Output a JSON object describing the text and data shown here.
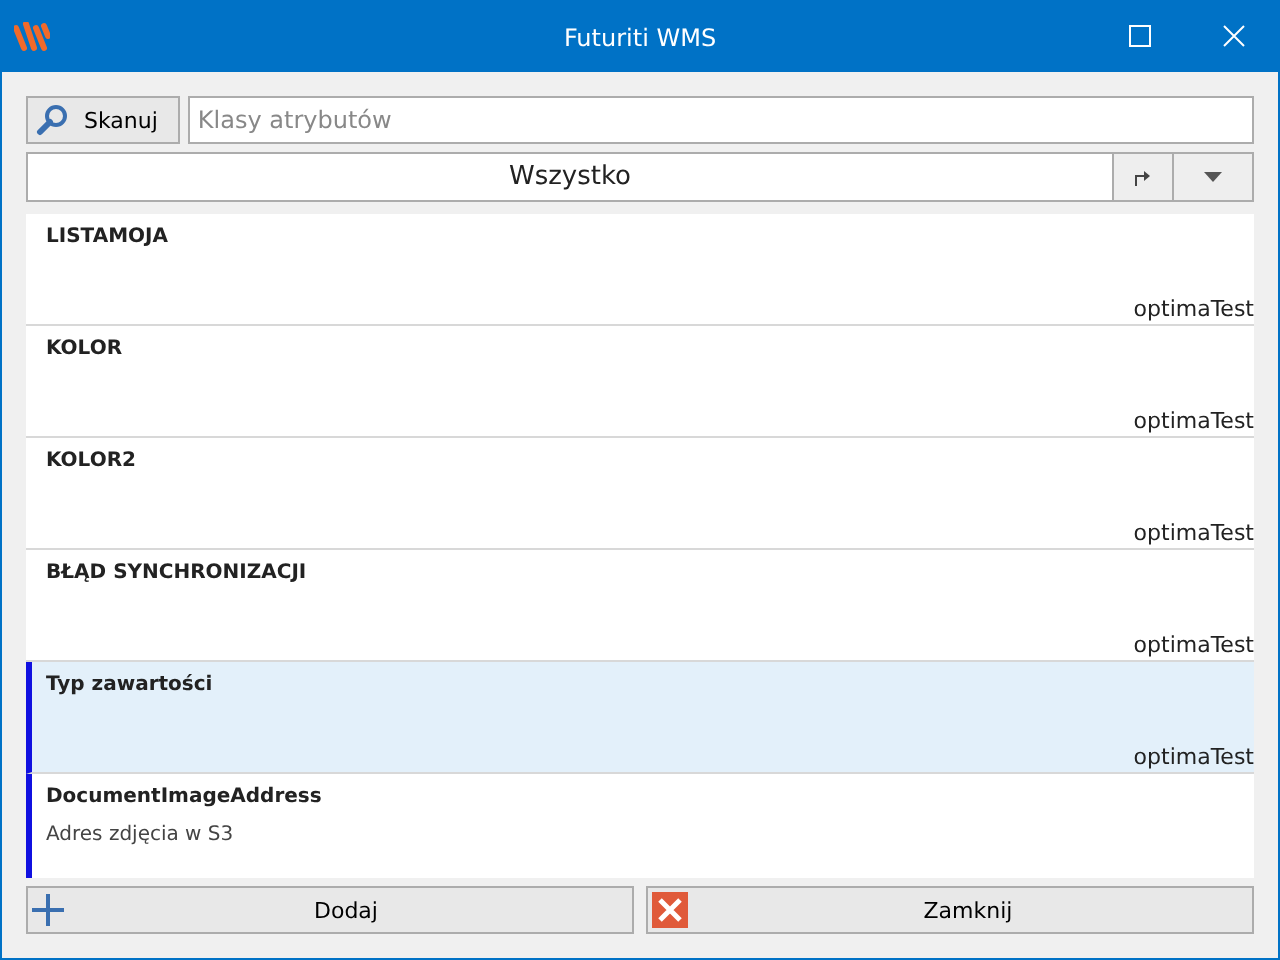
{
  "window": {
    "title": "Futuriti WMS"
  },
  "toolbar": {
    "scan_button": "Skanuj",
    "search": {
      "placeholder": "Klasy atrybutów"
    }
  },
  "filter": {
    "value": "Wszystko"
  },
  "items": [
    {
      "title": "LISTAMOJA",
      "owner": "optimaTest",
      "selected": false,
      "marked": false
    },
    {
      "title": "KOLOR",
      "owner": "optimaTest",
      "selected": false,
      "marked": false
    },
    {
      "title": "KOLOR2",
      "owner": "optimaTest",
      "selected": false,
      "marked": false
    },
    {
      "title": "BŁĄD SYNCHRONIZACJI",
      "owner": "optimaTest",
      "selected": false,
      "marked": false
    },
    {
      "title": "Typ zawartości",
      "owner": "optimaTest",
      "selected": true,
      "marked": true
    },
    {
      "title": "DocumentImageAddress",
      "description": "Adres zdjęcia w S3",
      "selected": false,
      "marked": true
    }
  ],
  "buttons": {
    "add": "Dodaj",
    "close": "Zamknij"
  }
}
